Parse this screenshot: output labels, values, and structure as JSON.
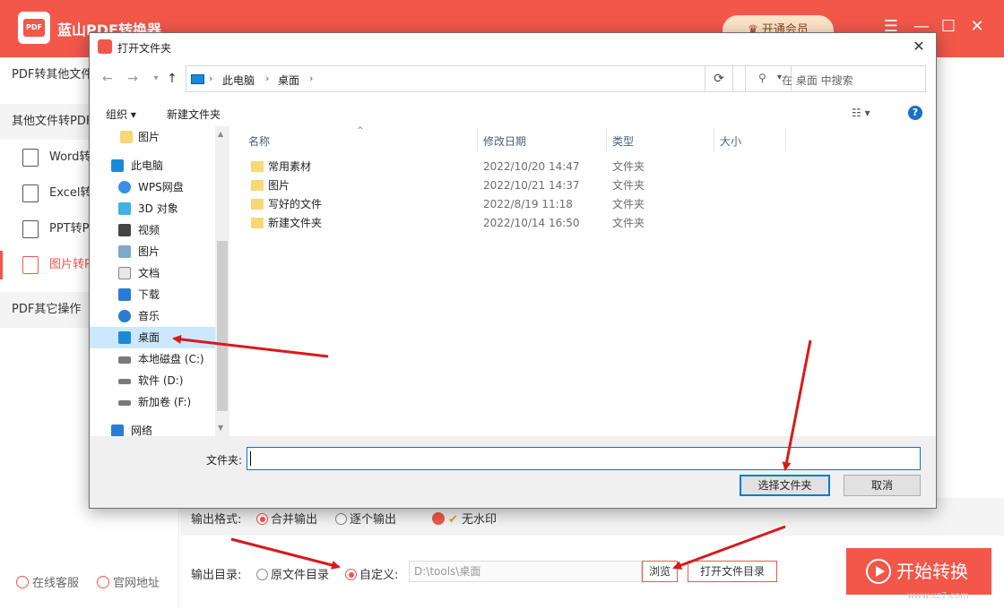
{
  "app": {
    "logo_text": "PDF",
    "title": "蓝山PDF转换器",
    "vip_label": "开通会员",
    "win_controls": [
      "☰",
      "—",
      "☐",
      "✕"
    ]
  },
  "sidebar": {
    "section1": "PDF转其他文件",
    "section2": "其他文件转PDF",
    "items": [
      "Word转PDF",
      "Excel转PDF",
      "PPT转PDF",
      "图片转PDF"
    ],
    "section3": "PDF其它操作",
    "footer": [
      "在线客服",
      "官网地址"
    ]
  },
  "settings": {
    "format_label": "输出格式:",
    "merge_label": "合并输出",
    "single_label": "逐个输出",
    "nowatermark_label": "无水印",
    "dir_label": "输出目录:",
    "original_label": "原文件目录",
    "custom_label": "自定义:",
    "path_value": "D:\\tools\\桌面",
    "browse_label": "浏览",
    "open_dir_label": "打开文件目录",
    "start_label": "开始转换"
  },
  "watermark": "www.xz7.com",
  "dialog": {
    "title": "打开文件夹",
    "close": "✕",
    "breadcrumb": [
      "此电脑",
      "桌面"
    ],
    "search_placeholder": "在 桌面 中搜索",
    "toolbar": {
      "organize": "组织 ▾",
      "new_folder": "新建文件夹"
    },
    "nav_items": [
      {
        "label": "图片",
        "icon": "folder-icon"
      },
      {
        "label": "此电脑",
        "icon": "computer-icon"
      },
      {
        "label": "WPS网盘",
        "icon": "cloud-icon"
      },
      {
        "label": "3D 对象",
        "icon": "cube-icon"
      },
      {
        "label": "视频",
        "icon": "video-icon"
      },
      {
        "label": "图片",
        "icon": "picture-icon"
      },
      {
        "label": "文档",
        "icon": "document-icon"
      },
      {
        "label": "下载",
        "icon": "download-icon"
      },
      {
        "label": "音乐",
        "icon": "music-icon"
      },
      {
        "label": "桌面",
        "icon": "desktop-icon"
      },
      {
        "label": "本地磁盘 (C:)",
        "icon": "drive-icon"
      },
      {
        "label": "软件 (D:)",
        "icon": "drive-icon"
      },
      {
        "label": "新加卷 (F:)",
        "icon": "drive-icon"
      },
      {
        "label": "网络",
        "icon": "network-icon"
      }
    ],
    "columns": [
      "名称",
      "修改日期",
      "类型",
      "大小"
    ],
    "files": [
      {
        "name": "常用素材",
        "date": "2022/10/20 14:47",
        "type": "文件夹"
      },
      {
        "name": "图片",
        "date": "2022/10/21 14:37",
        "type": "文件夹"
      },
      {
        "name": "写好的文件",
        "date": "2022/8/19 11:18",
        "type": "文件夹"
      },
      {
        "name": "新建文件夹",
        "date": "2022/10/14 16:50",
        "type": "文件夹"
      }
    ],
    "folder_label": "文件夹:",
    "folder_value": "",
    "select_label": "选择文件夹",
    "cancel_label": "取消"
  },
  "colors": {
    "brand": "#f2574a",
    "selection": "#cce8ff",
    "focus": "#0078d7",
    "annotation_arrow": "#d8191a"
  }
}
